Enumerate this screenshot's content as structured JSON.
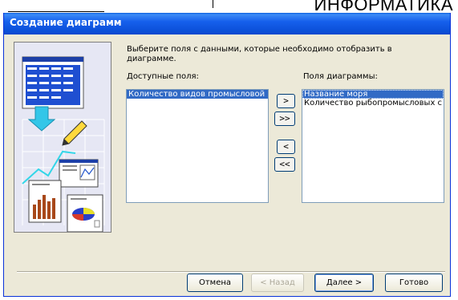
{
  "document": {
    "heading": "ИНФОРМАТИКА"
  },
  "dialog": {
    "title": "Создание диаграмм",
    "instruction": "Выберите поля с данными, которые необходимо отобразить в диаграмме.",
    "available_label": "Доступные поля:",
    "chart_fields_label": "Поля диаграммы:",
    "available_fields": [
      "Количество  видов промысловой"
    ],
    "chart_fields": [
      "Название моря",
      "Количество рыбопромысловых с"
    ],
    "move_buttons": {
      "add_one": ">",
      "add_all": ">>",
      "remove_one": "<",
      "remove_all": "<<"
    },
    "buttons": {
      "cancel": "Отмена",
      "back": "< Назад",
      "next": "Далее >",
      "finish": "Готово"
    },
    "accent": "#0a5fe0",
    "selection_color": "#316ac5"
  }
}
